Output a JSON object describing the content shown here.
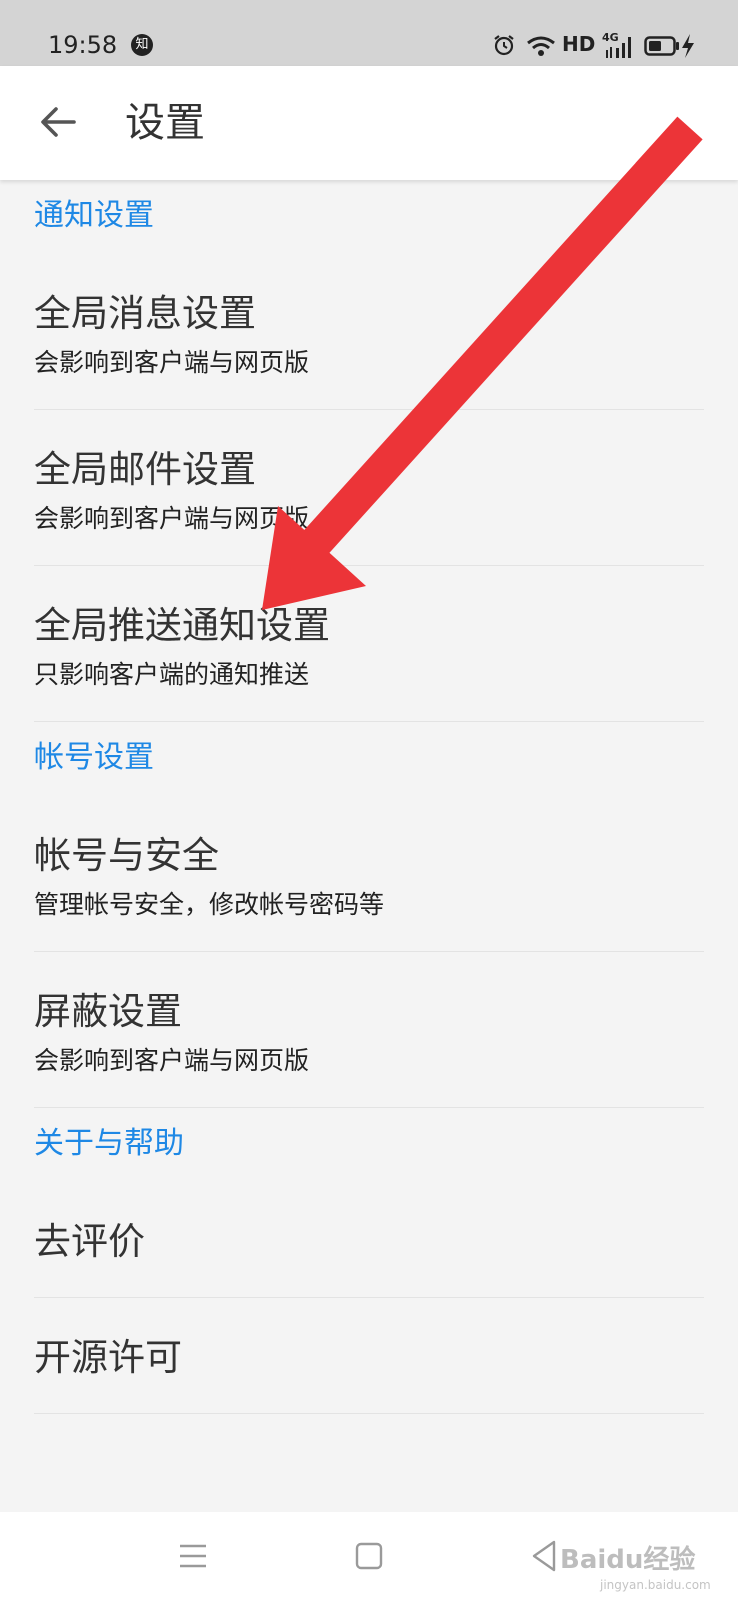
{
  "status_bar": {
    "time": "19:58",
    "badge": "知",
    "hd": "HD",
    "network": "4G",
    "icons": [
      "alarm-icon",
      "wifi-icon",
      "signal-icon",
      "battery-icon",
      "charging-icon"
    ]
  },
  "app_bar": {
    "back_icon": "arrow-left-icon",
    "title": "设置"
  },
  "sections": [
    {
      "header": "通知设置",
      "items": [
        {
          "title": "全局消息设置",
          "subtitle": "会影响到客户端与网页版"
        },
        {
          "title": "全局邮件设置",
          "subtitle": "会影响到客户端与网页版"
        },
        {
          "title": "全局推送通知设置",
          "subtitle": "只影响客户端的通知推送"
        }
      ]
    },
    {
      "header": "帐号设置",
      "items": [
        {
          "title": "帐号与安全",
          "subtitle": "管理帐号安全，修改帐号密码等"
        },
        {
          "title": "屏蔽设置",
          "subtitle": "会影响到客户端与网页版"
        }
      ]
    },
    {
      "header": "关于与帮助",
      "items": [
        {
          "title": "去评价"
        },
        {
          "title": "开源许可"
        }
      ]
    }
  ],
  "nav_bar": {
    "icons": [
      "menu-icon",
      "home-icon",
      "back-icon"
    ]
  },
  "watermark": {
    "text": "Baidu经验",
    "sub": "jingyan.baidu.com"
  },
  "colors": {
    "accent": "#1e88e5",
    "arrow": "#ec3438",
    "background": "#f4f4f4",
    "status_bar": "#d4d4d4"
  }
}
